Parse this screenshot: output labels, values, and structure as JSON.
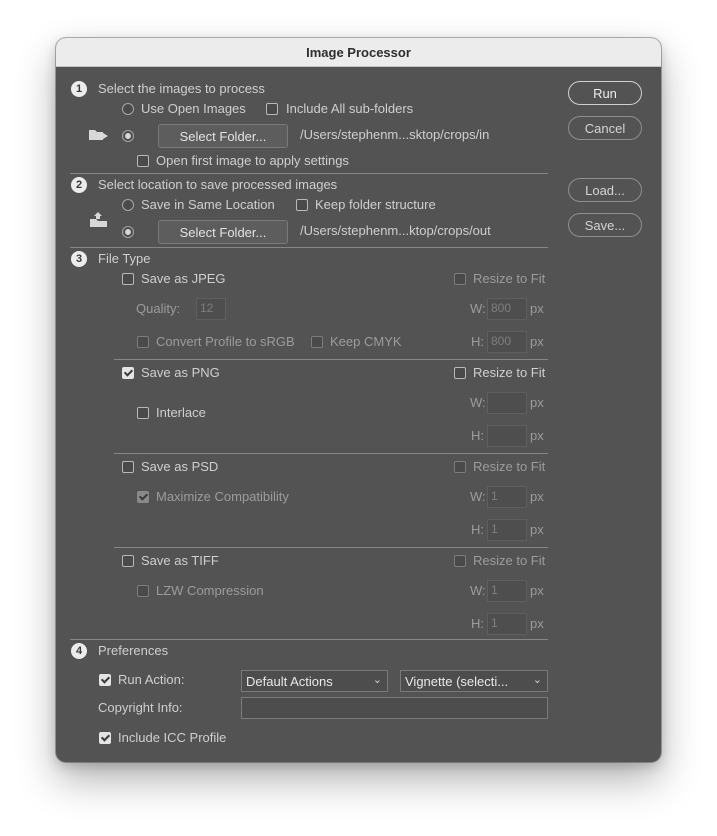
{
  "window": {
    "title": "Image Processor"
  },
  "buttons": {
    "run": "Run",
    "cancel": "Cancel",
    "load": "Load...",
    "save": "Save..."
  },
  "section1": {
    "number": "1",
    "heading": "Select the images to process",
    "use_open_images": "Use Open Images",
    "include_subfolders": "Include All sub-folders",
    "select_folder": "Select Folder...",
    "path": "/Users/stephenm...sktop/crops/in",
    "open_first": "Open first image to apply settings"
  },
  "section2": {
    "number": "2",
    "heading": "Select location to save processed images",
    "same_location": "Save in Same Location",
    "keep_structure": "Keep folder structure",
    "select_folder": "Select Folder...",
    "path": "/Users/stephenm...ktop/crops/out"
  },
  "section3": {
    "number": "3",
    "heading": "File Type",
    "jpeg": {
      "save": "Save as JPEG",
      "resize": "Resize to Fit",
      "quality_label": "Quality:",
      "quality": "12",
      "w_label": "W:",
      "w": "800",
      "h_label": "H:",
      "h": "800",
      "px": "px",
      "convert": "Convert Profile to sRGB",
      "keep_cmyk": "Keep CMYK"
    },
    "png": {
      "save": "Save as PNG",
      "resize": "Resize to Fit",
      "interlace": "Interlace",
      "w_label": "W:",
      "w": "",
      "h_label": "H:",
      "h": "",
      "px": "px"
    },
    "psd": {
      "save": "Save as PSD",
      "resize": "Resize to Fit",
      "maximize": "Maximize Compatibility",
      "w_label": "W:",
      "w": "1",
      "h_label": "H:",
      "h": "1",
      "px": "px"
    },
    "tiff": {
      "save": "Save as TIFF",
      "resize": "Resize to Fit",
      "lzw": "LZW Compression",
      "w_label": "W:",
      "w": "1",
      "h_label": "H:",
      "h": "1",
      "px": "px"
    }
  },
  "section4": {
    "number": "4",
    "heading": "Preferences",
    "run_action": "Run Action:",
    "action_set": "Default Actions",
    "action": "Vignette (selecti...",
    "copyright": "Copyright Info:",
    "copyright_value": "",
    "icc": "Include ICC Profile"
  },
  "icons": {
    "open_folder": "folder-open-icon",
    "save_folder": "folder-save-icon",
    "chevron": "chevron-down-icon"
  }
}
